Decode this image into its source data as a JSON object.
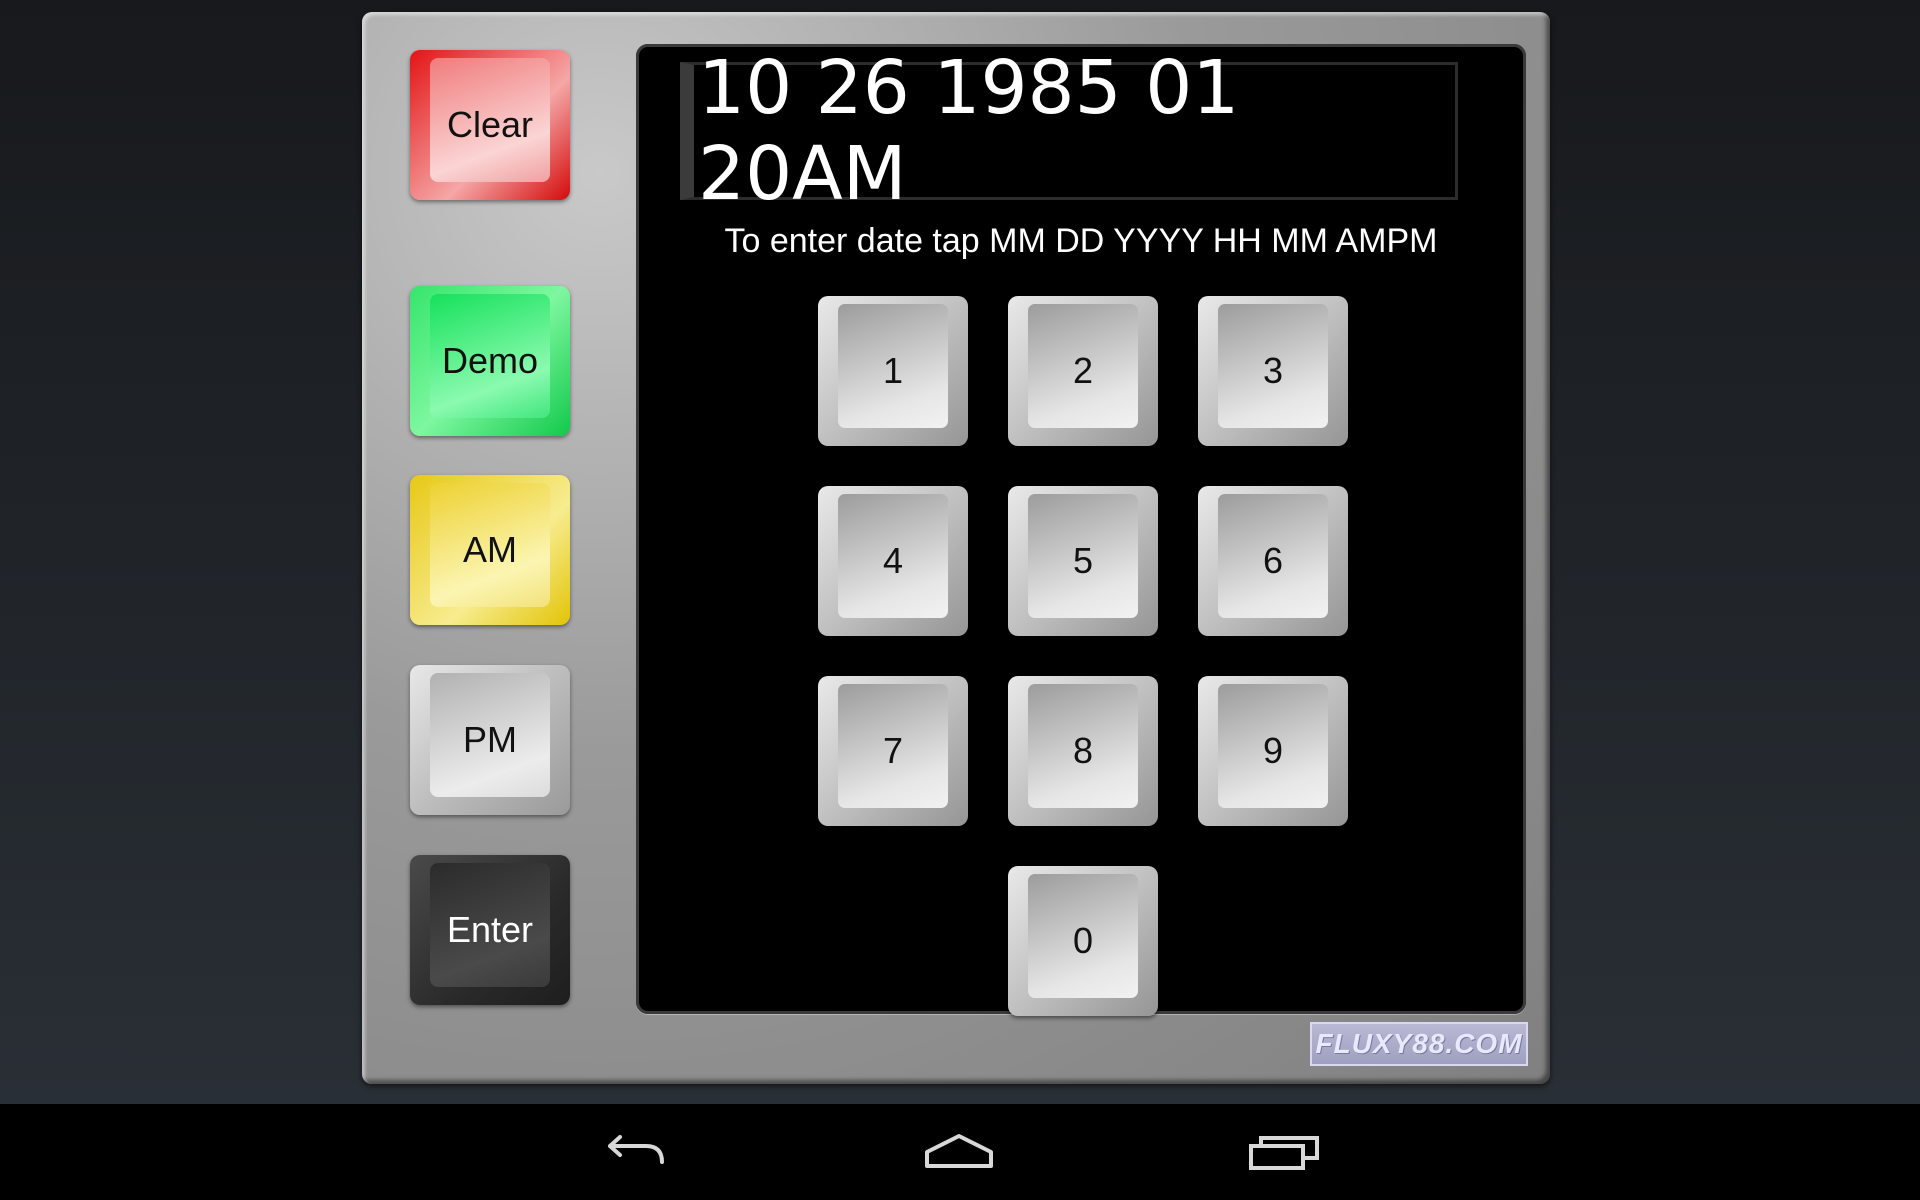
{
  "display": {
    "value": "10 26 1985 01 20AM"
  },
  "instruction": "To enter date tap MM DD YYYY HH MM AMPM",
  "side_buttons": {
    "clear": "Clear",
    "demo": "Demo",
    "am": "AM",
    "pm": "PM",
    "enter": "Enter"
  },
  "keys": {
    "k1": "1",
    "k2": "2",
    "k3": "3",
    "k4": "4",
    "k5": "5",
    "k6": "6",
    "k7": "7",
    "k8": "8",
    "k9": "9",
    "k0": "0"
  },
  "watermark": "FLUXY88.COM",
  "colors": {
    "clear": "#e31414",
    "demo": "#22d95f",
    "am": "#e7c816",
    "pm": "#c8c8c8",
    "enter": "#2e2e2e",
    "screen": "#000000",
    "panel": "#9a9a9a"
  },
  "navbar": {
    "icons": [
      "back-icon",
      "home-icon",
      "recent-apps-icon"
    ]
  }
}
